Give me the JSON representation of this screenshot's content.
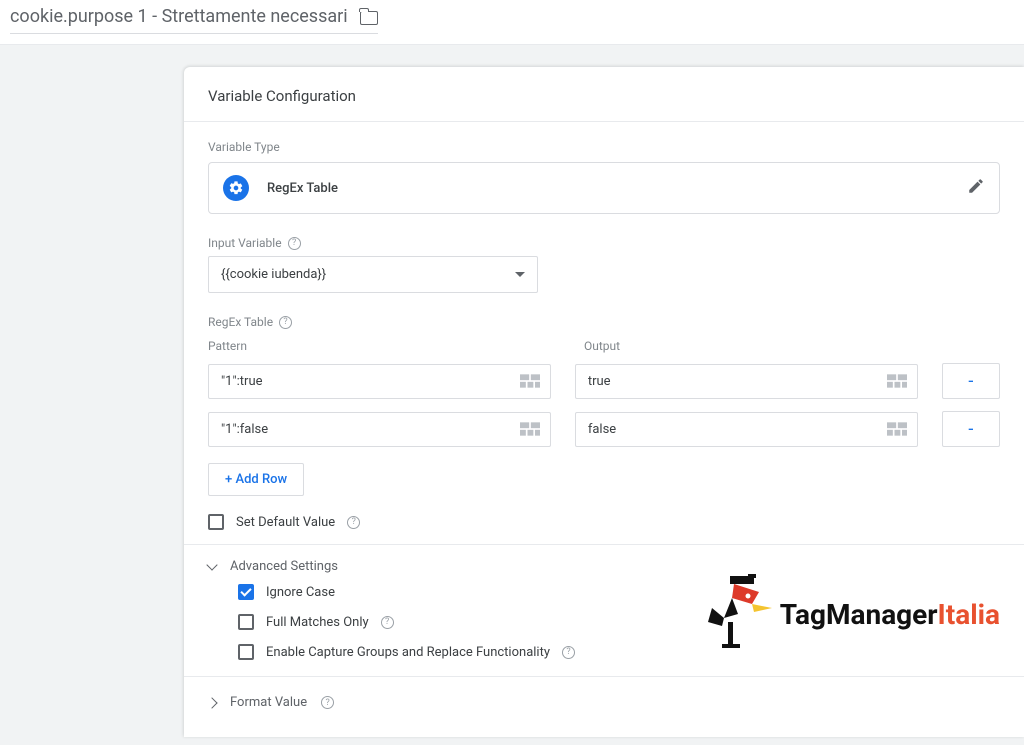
{
  "header": {
    "title": "cookie.purpose 1 - Strettamente necessari"
  },
  "panel": {
    "title": "Variable Configuration",
    "type_section_label": "Variable Type",
    "type_name": "RegEx Table",
    "input_var_label": "Input Variable",
    "input_var_value": "{{cookie iubenda}}",
    "regex_label": "RegEx Table",
    "col_pattern": "Pattern",
    "col_output": "Output",
    "rows": [
      {
        "pattern": "\"1\":true",
        "output": "true"
      },
      {
        "pattern": "\"1\":false",
        "output": "false"
      }
    ],
    "add_row": "+ Add Row",
    "default_label": "Set Default Value",
    "adv_label": "Advanced Settings",
    "opts": {
      "ignore_case": "Ignore Case",
      "full_match": "Full Matches Only",
      "capture": "Enable Capture Groups and Replace Functionality"
    },
    "format_label": "Format Value",
    "remove_glyph": "-"
  },
  "watermark": {
    "a": "TagManager",
    "b": "Italia"
  }
}
